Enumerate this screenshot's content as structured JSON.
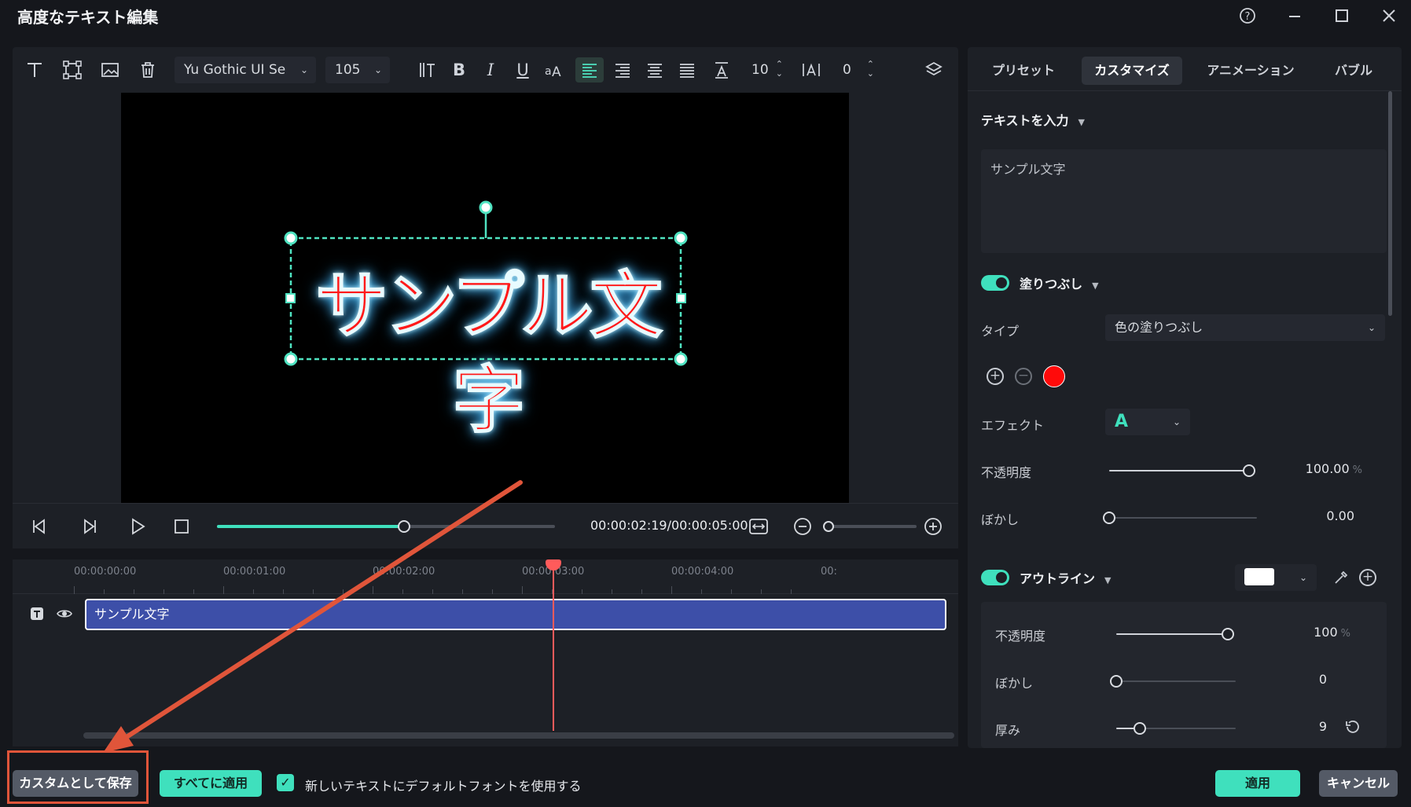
{
  "window": {
    "title": "高度なテキスト編集",
    "help_icon": "help-circle-icon",
    "minimize_icon": "minimize-icon",
    "maximize_icon": "maximize-icon",
    "close_icon": "close-icon"
  },
  "toolbar": {
    "font_family": "Yu Gothic UI Se",
    "font_size": "105",
    "line_spacing": "10",
    "char_spacing": "0",
    "icons": [
      "text-icon",
      "transform-icon",
      "image-icon",
      "delete-icon",
      "text-height-icon",
      "bold-icon",
      "italic-icon",
      "underline-icon",
      "case-icon",
      "align-left-icon",
      "align-right-icon",
      "align-center-icon",
      "align-justify-icon",
      "baseline-icon",
      "letter-spacing-icon",
      "layer-icon"
    ],
    "labels": {
      "bold": "B",
      "italic": "I",
      "underline": "U"
    }
  },
  "preview": {
    "text": "サンプル文字",
    "text_color": "#ff1a1a",
    "glow_color": "#5fd2ff"
  },
  "playback": {
    "timecode": "00:00:02:19/00:00:05:00",
    "progress": 0.554,
    "zoom_level": 0.0
  },
  "timeline": {
    "ticks": [
      "00:00:00:00",
      "00:00:01:00",
      "00:00:02:00",
      "00:00:03:00",
      "00:00:04:00",
      "00:"
    ],
    "clip_label": "サンプル文字",
    "playhead_time": "00:00:02:19"
  },
  "panel": {
    "tabs": [
      {
        "label": "プリセット",
        "active": false
      },
      {
        "label": "カスタマイズ",
        "active": true
      },
      {
        "label": "アニメーション",
        "active": false
      },
      {
        "label": "バブル",
        "active": false
      }
    ],
    "text_input": {
      "title": "テキストを入力",
      "value": "サンプル文字"
    },
    "fill": {
      "title": "塗りつぶし",
      "enabled": true,
      "type_label": "タイプ",
      "type_value": "色の塗りつぶし",
      "color": "#ff0a0a",
      "effect_label": "エフェクト",
      "effect_glyph": "A",
      "opacity_label": "不透明度",
      "opacity_value": "100.00",
      "opacity_unit": "%",
      "opacity_level": 1.0,
      "blur_label": "ぼかし",
      "blur_value": "0.00",
      "blur_level": 0.0
    },
    "outline": {
      "title": "アウトライン",
      "enabled": true,
      "color": "#ffffff",
      "opacity_label": "不透明度",
      "opacity_value": "100",
      "opacity_unit": "%",
      "opacity_level": 1.0,
      "blur_label": "ぼかし",
      "blur_value": "0",
      "blur_level": 0.0,
      "thickness_label": "厚み",
      "thickness_value": "9",
      "thickness_level": 0.2
    }
  },
  "footer": {
    "save_custom": "カスタムとして保存",
    "apply_all": "すべてに適用",
    "default_font_label": "新しいテキストにデフォルトフォントを使用する",
    "default_font_checked": true,
    "apply": "適用",
    "cancel": "キャンセル"
  },
  "colors": {
    "accent": "#3fe0bd",
    "annotation": "#e0553a",
    "playhead": "#ff5b5b",
    "clip": "#3d4fa8"
  }
}
